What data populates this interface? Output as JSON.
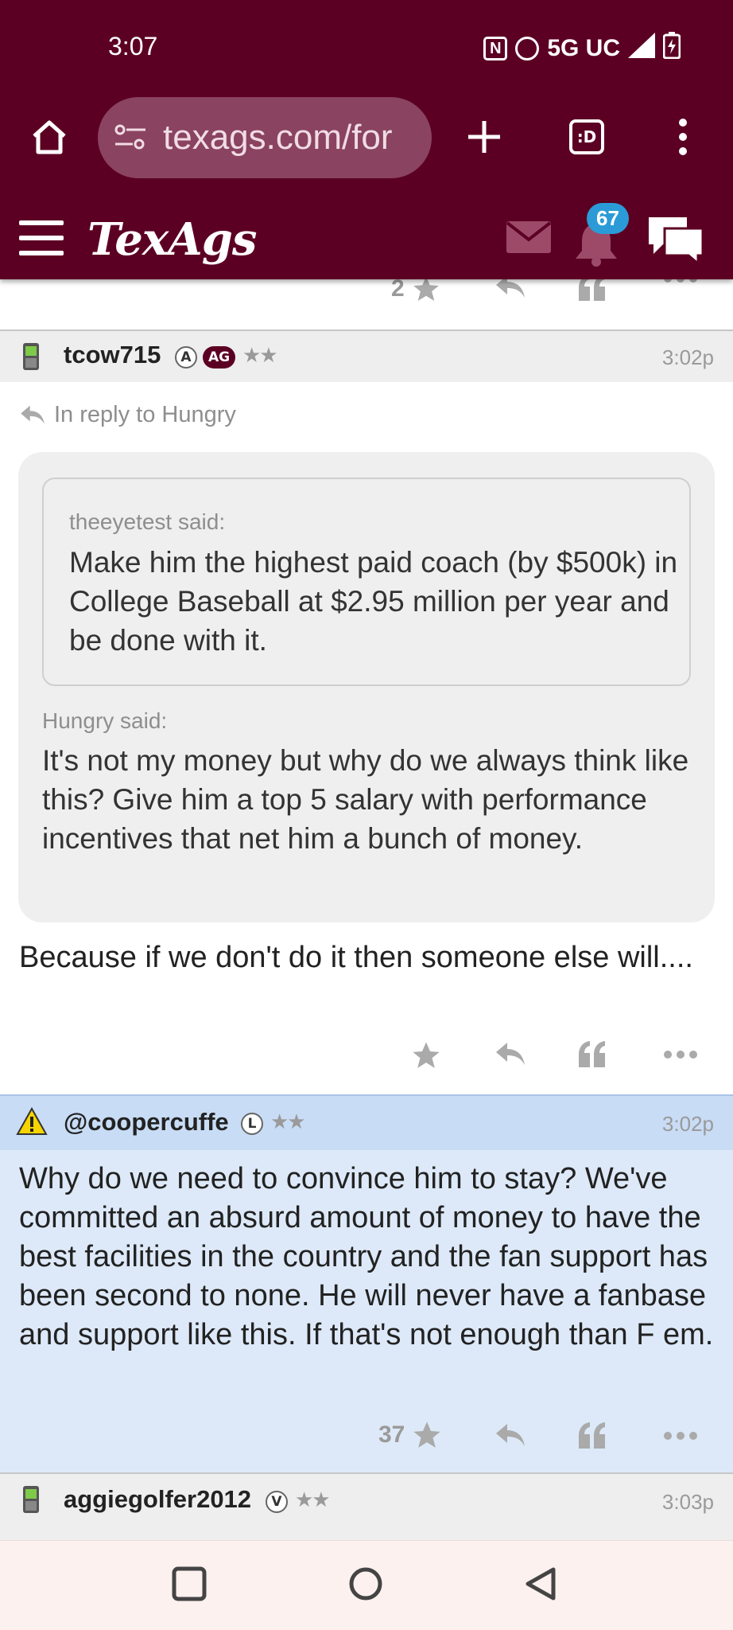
{
  "status_bar": {
    "time": "3:07",
    "network": "5G UC"
  },
  "browser": {
    "url": "texags.com/for",
    "tab_count_label": ":D"
  },
  "site": {
    "logo": "TexAgs",
    "notification_count": "67"
  },
  "prev_post": {
    "star_count": "2"
  },
  "posts": [
    {
      "username": "tcow715",
      "badges": [
        "A",
        "AG"
      ],
      "time": "3:02p",
      "reply_to": "In reply to Hungry",
      "nested_quote": {
        "said": "theeyetest said:",
        "text": "Make him the highest paid coach (by $500k) in College Baseball at $2.95 million per year and be done with it."
      },
      "quote": {
        "said": "Hungry said:",
        "text": "It's not my money but why do we always think like this? Give him a top 5 salary with performance incentives that net him a bunch of money."
      },
      "body": "Because if we don't do it then someone else will....",
      "star_count": ""
    },
    {
      "username": "@coopercuffe",
      "badges": [
        "L"
      ],
      "time": "3:02p",
      "body": "Why do we need to convince him to stay? We've committed an absurd amount of money to have the best facilities in the country and the fan support has been second to none. He will never have a fanbase and support like this. If that's not enough than F em.",
      "star_count": "37"
    },
    {
      "username": "aggiegolfer2012",
      "badges": [
        "V"
      ],
      "time": "3:03p"
    }
  ],
  "colors": {
    "maroon": "#5c0023",
    "highlight_post_bg": "#dde9f8",
    "header_gray": "#eeeeee",
    "badge_blue": "#2a9bd6"
  }
}
